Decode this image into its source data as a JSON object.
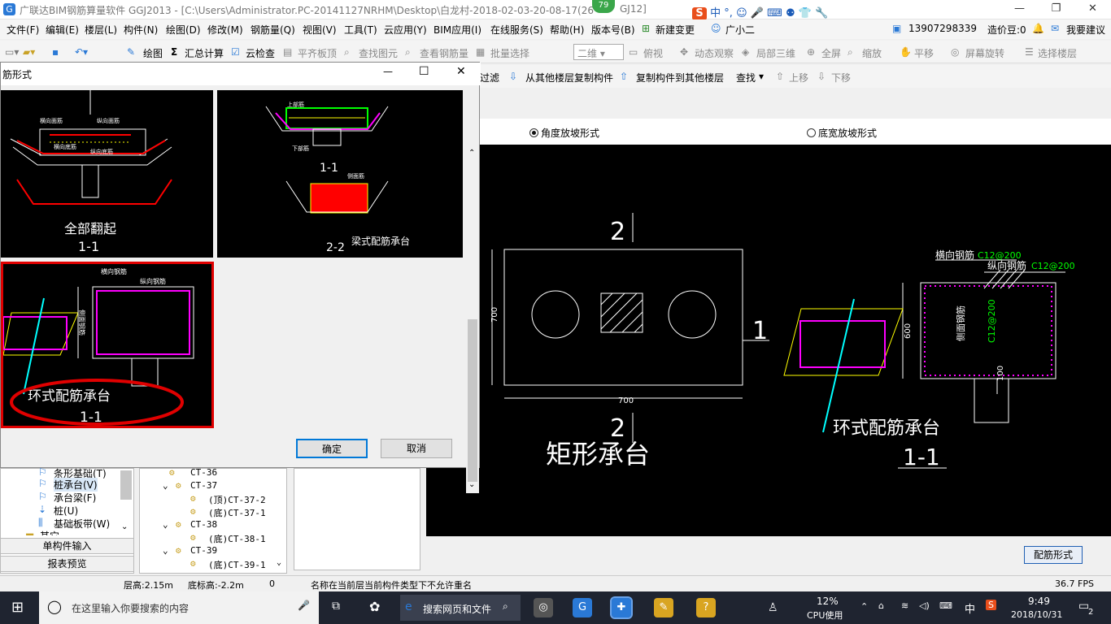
{
  "window": {
    "title": "广联达BIM钢筋算量软件 GGJ2013 - [C:\\Users\\Administrator.PC-20141127NRHM\\Desktop\\白龙村-2018-02-03-20-08-17(26",
    "title_tail": "GJ12]",
    "badge": "79",
    "min": "—",
    "max": "❐",
    "close": "✕"
  },
  "ime": {
    "s": "S",
    "lang": "中",
    "punct": "°,",
    "emoji": "☺",
    "mic": "🎤",
    "kbd": "⌨",
    "users": "⚉",
    "shirt": "👕",
    "tool": "🔧"
  },
  "menu": [
    "文件(F)",
    "编辑(E)",
    "楼层(L)",
    "构件(N)",
    "绘图(D)",
    "修改(M)",
    "钢筋量(Q)",
    "视图(V)",
    "工具(T)",
    "云应用(Y)",
    "BIM应用(I)",
    "在线服务(S)",
    "帮助(H)",
    "版本号(B)",
    "新建变更",
    "广小二"
  ],
  "menu_right": {
    "phone": "13907298339",
    "coins": "造价豆:0",
    "suggest": "我要建议"
  },
  "toolbar1": {
    "draw": "绘图",
    "sum": "汇总计算",
    "cloudcheck": "云检查",
    "align": "平齐板顶",
    "find": "查找图元",
    "view": "查看钢筋量",
    "batch": "批量选择",
    "mode": "二维",
    "top": "俯视",
    "dynamic": "动态观察",
    "local3d": "局部三维",
    "full": "全屏",
    "zoom": "缩放",
    "pan": "平移",
    "rotate": "屏幕旋转",
    "selectfloor": "选择楼层"
  },
  "toolbar2": {
    "filter": "过滤",
    "copyfrom": "从其他楼层复制构件",
    "copyto": "复制构件到其他楼层",
    "find": "查找",
    "up": "上移",
    "down": "下移"
  },
  "radios": {
    "angle": "角度放坡形式",
    "bottom": "底宽放坡形式"
  },
  "dialog": {
    "title": "筋形式",
    "min": "—",
    "max": "☐",
    "close": "✕",
    "ok": "确定",
    "cancel": "取消",
    "thumb1": {
      "main": "全部翻起",
      "sec": "1-1",
      "lbl1": "横向面筋",
      "lbl2": "纵向面筋",
      "lbl3": "横向底筋",
      "lbl4": "纵向底筋"
    },
    "thumb2": {
      "main": "梁式配筋承台",
      "sec1": "1-1",
      "sec2": "2-2",
      "lbl1": "上部筋",
      "lbl2": "下部筋",
      "lbl3": "侧面筋"
    },
    "thumb3": {
      "main": "环式配筋承台",
      "sec": "1-1",
      "lbl1": "横向钢筋",
      "lbl2": "纵向钢筋",
      "lbl3": "侧面钢筋"
    }
  },
  "cad": {
    "plan_title": "矩形承台",
    "sec2_top": "2",
    "sec2_bot": "2",
    "sec1": "1",
    "dim_h": "700",
    "dim_w": "700",
    "ring_title": "环式配筋承台",
    "ring_sec": "1-1",
    "h_bar": "横向钢筋",
    "h_bar_val": "C12@200",
    "v_bar": "纵向钢筋",
    "v_bar_val": "C12@200",
    "side_bar": "侧面钢筋",
    "side_bar_val": "C12@200",
    "dim_600": "600",
    "dim_100": "100"
  },
  "config_button": "配筋形式",
  "tree_left": [
    "条形基础(T)",
    "桩承台(V)",
    "承台梁(F)",
    "桩(U)",
    "基础板带(W)",
    "其它"
  ],
  "nav": {
    "single": "单构件输入",
    "report": "报表预览"
  },
  "tree_mid": [
    "CT-36",
    "CT-37",
    "(顶)CT-37-2",
    "(底)CT-37-1",
    "CT-38",
    "(底)CT-38-1",
    "CT-39",
    "(底)CT-39-1"
  ],
  "status": {
    "floor_h": "层高:2.15m",
    "base_h": "底标高:-2.2m",
    "zero": "0",
    "msg": "名称在当前层当前构件类型下不允许重名",
    "fps": "36.7 FPS"
  },
  "taskbar": {
    "search": "在这里输入你要搜索的内容",
    "browser": "搜索网页和文件",
    "cpu": "12%",
    "cpu_label": "CPU使用",
    "time": "9:49",
    "date": "2018/10/31",
    "ime": "中",
    "notify": "2"
  }
}
